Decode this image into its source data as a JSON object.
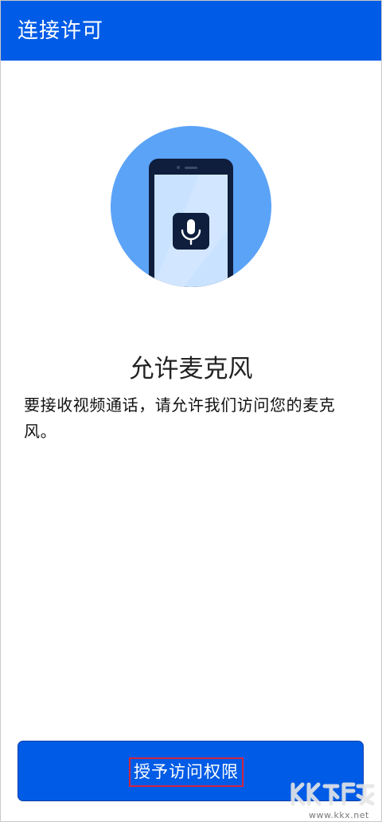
{
  "app_bar": {
    "title": "连接许可"
  },
  "illustration": {
    "icon": "microphone-icon"
  },
  "permission": {
    "title": "允许麦克风",
    "description": "要接收视频通话，请允许我们访问您的麦克风。"
  },
  "actions": {
    "grant_label": "授予访问权限"
  },
  "watermark": {
    "logo_text": "KK下载",
    "url": "www.kkx.net"
  },
  "colors": {
    "primary": "#005ce6",
    "circle": "#5ba3f7",
    "phone_body": "#0f1e3d",
    "phone_screen": "#c9e2ff",
    "highlight_box": "#d2243f"
  }
}
